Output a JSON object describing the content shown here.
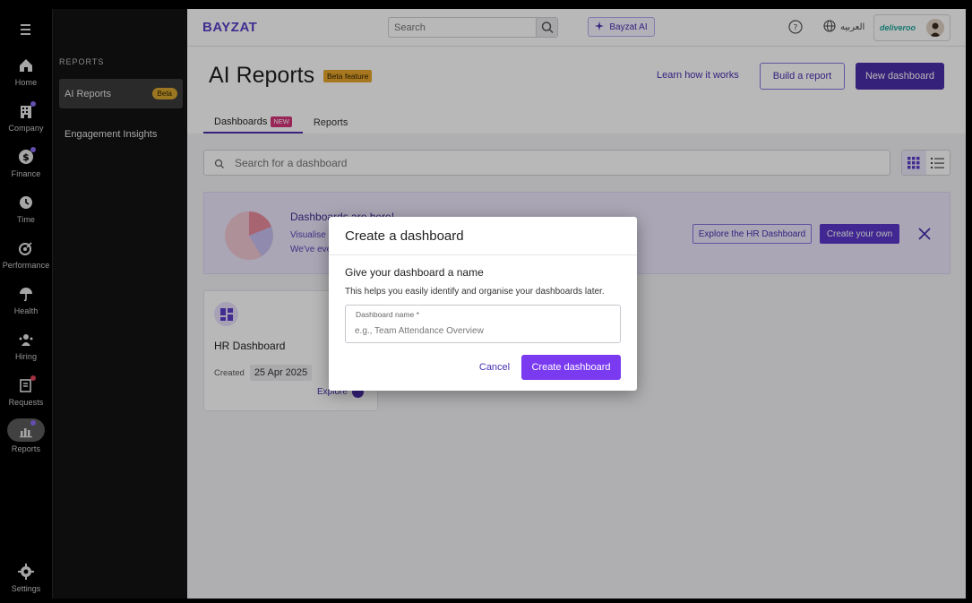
{
  "rail": {
    "items": [
      {
        "label": "Home",
        "icon": "home-icon"
      },
      {
        "label": "Company",
        "icon": "building-icon"
      },
      {
        "label": "Finance",
        "icon": "dollar-icon"
      },
      {
        "label": "Time",
        "icon": "clock-icon"
      },
      {
        "label": "Performance",
        "icon": "target-icon"
      },
      {
        "label": "Health",
        "icon": "umbrella-icon"
      },
      {
        "label": "Hiring",
        "icon": "people-icon"
      },
      {
        "label": "Requests",
        "icon": "request-icon"
      },
      {
        "label": "Reports",
        "icon": "reports-icon"
      }
    ],
    "settings_label": "Settings"
  },
  "sidebar": {
    "heading": "REPORTS",
    "items": [
      {
        "label": "AI Reports",
        "badge": "Beta"
      },
      {
        "label": "Engagement Insights"
      }
    ]
  },
  "topbar": {
    "logo": "BAYZAT",
    "search_placeholder": "Search",
    "ai_button": "Bayzat AI",
    "language": "العربيه",
    "company": "deliveroo"
  },
  "header": {
    "title": "AI Reports",
    "beta_badge": "Beta feature",
    "learn_link": "Learn how it works",
    "build_button": "Build a report",
    "new_button": "New dashboard",
    "tabs": [
      {
        "label": "Dashboards",
        "badge": "NEW"
      },
      {
        "label": "Reports"
      }
    ]
  },
  "dashboard_search": {
    "placeholder": "Search for a dashboard"
  },
  "banner": {
    "title": "Dashboards are here!",
    "line1": "Visualise",
    "line2": "We've eve",
    "explore_button": "Explore the HR Dashboard",
    "create_button": "Create your own"
  },
  "card": {
    "title": "HR Dashboard",
    "created_label": "Created",
    "created_date": "25 Apr 2025",
    "explore_link": "Explore"
  },
  "modal": {
    "title": "Create a dashboard",
    "subtitle": "Give your dashboard a name",
    "help": "This helps you easily identify and organise your dashboards later.",
    "field_label": "Dashboard name *",
    "field_placeholder": "e.g., Team Attendance Overview",
    "field_value": "",
    "cancel": "Cancel",
    "submit": "Create dashboard"
  },
  "colors": {
    "brand": "#5b3ec8",
    "primary_dark": "#4b2ea9",
    "primary_button": "#7a3bf0",
    "beta": "#d9a62e",
    "new_badge": "#d6357c"
  }
}
